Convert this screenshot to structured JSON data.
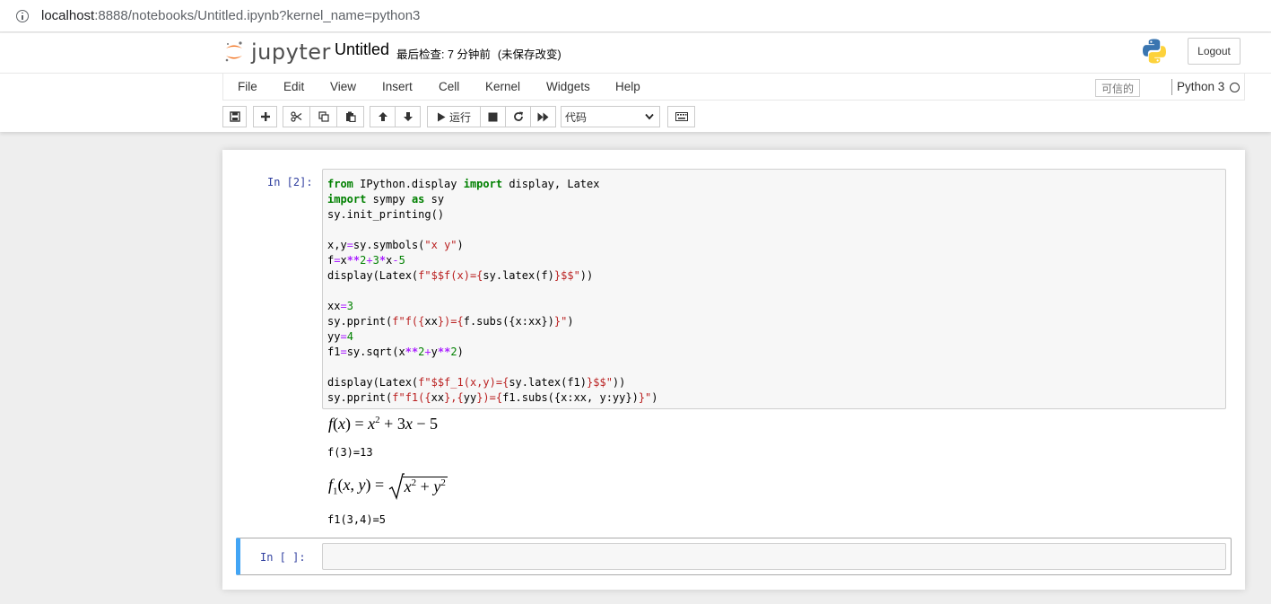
{
  "browser": {
    "url_host": "localhost",
    "url_rest": ":8888/notebooks/Untitled.ipynb?kernel_name=python3"
  },
  "header": {
    "logo_text": "jupyter",
    "notebook_title": "Untitled",
    "checkpoint_text": "最后检查: 7 分钟前",
    "unsaved_text": "(未保存改变)",
    "logout_label": "Logout"
  },
  "menubar": {
    "items": [
      {
        "label": "File"
      },
      {
        "label": "Edit"
      },
      {
        "label": "View"
      },
      {
        "label": "Insert"
      },
      {
        "label": "Cell"
      },
      {
        "label": "Kernel"
      },
      {
        "label": "Widgets"
      },
      {
        "label": "Help"
      }
    ],
    "trusted_label": "可信的",
    "kernel_name": "Python 3"
  },
  "toolbar": {
    "run_label": "运行",
    "cell_type_value": "代码"
  },
  "cells": {
    "cell1": {
      "prompt": "In  [2]:",
      "output_text_1": "f(3)=13",
      "output_text_2": "f1(3,4)=5"
    },
    "cell2": {
      "prompt": "In  [ ]:"
    }
  },
  "colors": {
    "prompt_blue": "#303f9f",
    "selected_cell_bar": "#42a5f5",
    "keyword_green": "#008000",
    "operator_purple": "#aa22ff",
    "string_red": "#ba2121"
  }
}
